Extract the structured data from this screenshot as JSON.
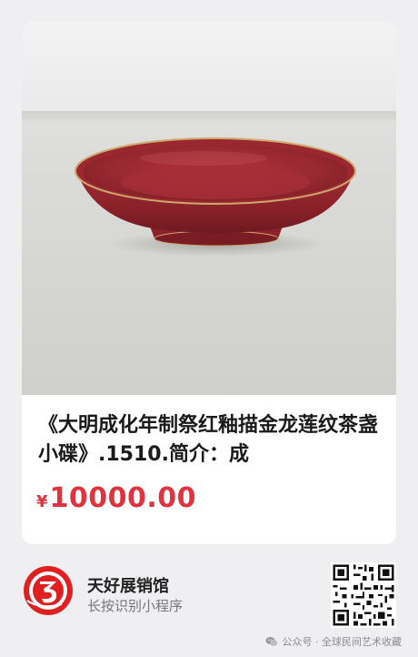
{
  "product": {
    "image_alt": "red glazed porcelain dish",
    "title": "《大明成化年制祭红釉描金龙莲纹茶盏小碟》.1510.简介：成",
    "currency_symbol": "¥",
    "price": "10000.00"
  },
  "mini_program": {
    "name": "天好展销馆",
    "hint": "长按识别小程序"
  },
  "watermark": {
    "text": "公众号 · 全球民间艺术收藏"
  },
  "colors": {
    "price": "#e0323f",
    "logo_red": "#e02020",
    "background": "#efeff1"
  },
  "icons": {
    "logo": "tianhao-logo-icon",
    "qr": "qr-code-icon",
    "watermark": "wechat-icon"
  }
}
